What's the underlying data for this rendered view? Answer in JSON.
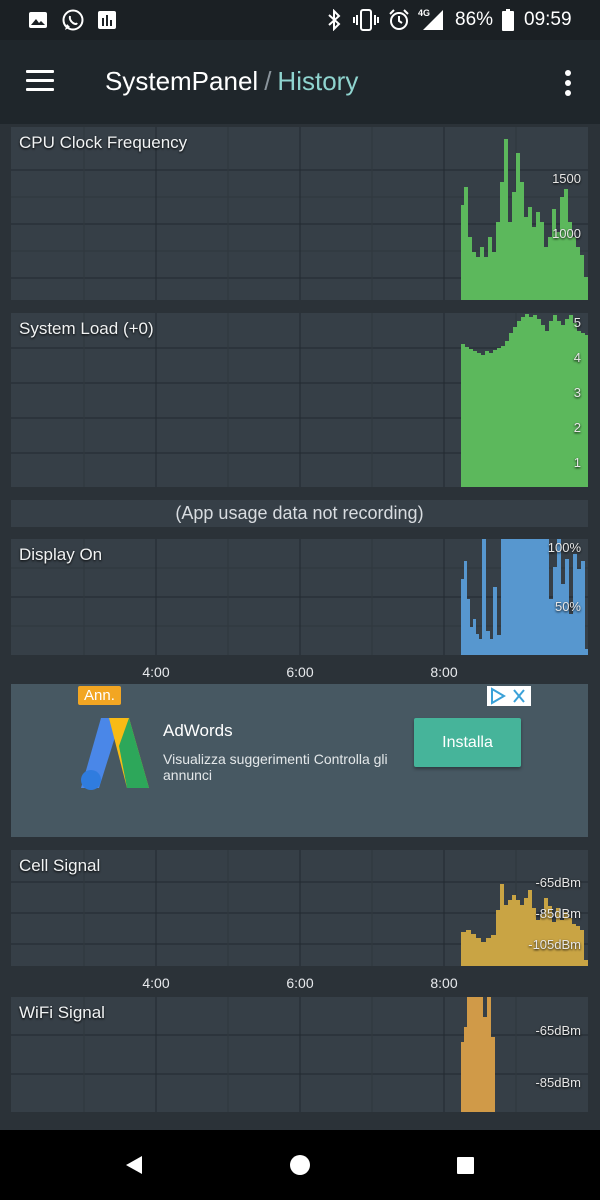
{
  "status_bar": {
    "battery_percent": "86%",
    "time": "09:59",
    "network": "4G",
    "left_icons": [
      "image-icon",
      "whatsapp-icon",
      "chart-icon"
    ],
    "right_icons": [
      "bluetooth-icon",
      "vibrate-icon",
      "alarm-icon",
      "signal-icon",
      "battery-icon"
    ]
  },
  "app_bar": {
    "app_name": "SystemPanel",
    "separator": "/",
    "section": "History",
    "menu_icon": "hamburger-menu-icon",
    "overflow_icon": "more-vert-icon"
  },
  "panels": {
    "cpu": {
      "label": "CPU Clock Frequency",
      "y_labels": [
        "1500",
        "1000"
      ]
    },
    "load": {
      "label": "System Load (+0)",
      "y_labels": [
        "5",
        "4",
        "3",
        "2",
        "1"
      ]
    },
    "display": {
      "label": "Display On",
      "y_labels": [
        "100%",
        "50%"
      ]
    },
    "cell": {
      "label": "Cell Signal",
      "y_labels": [
        "-65dBm",
        "-85dBm",
        "-105dBm"
      ]
    },
    "wifi": {
      "label": "WiFi Signal",
      "y_labels": [
        "-65dBm",
        "-85dBm"
      ]
    }
  },
  "notice": "(App usage data not recording)",
  "x_axis": [
    "4:00",
    "6:00",
    "8:00"
  ],
  "ad": {
    "badge": "Ann.",
    "title": "AdWords",
    "description": "Visualizza suggerimenti Controlla gli annunci",
    "button": "Installa"
  },
  "nav_bar": {
    "icons": [
      "back-icon",
      "home-icon",
      "recents-icon"
    ]
  },
  "colors": {
    "background": "#2b3238",
    "panel": "#363f47",
    "cpu_fill": "#5cb85c",
    "display_fill": "#5797cf",
    "cell_fill": "#c9a444",
    "wifi_fill": "#d09a48",
    "accent": "#8fd4cf",
    "ad_button": "#46b49a",
    "ad_badge": "#f2a623"
  }
}
